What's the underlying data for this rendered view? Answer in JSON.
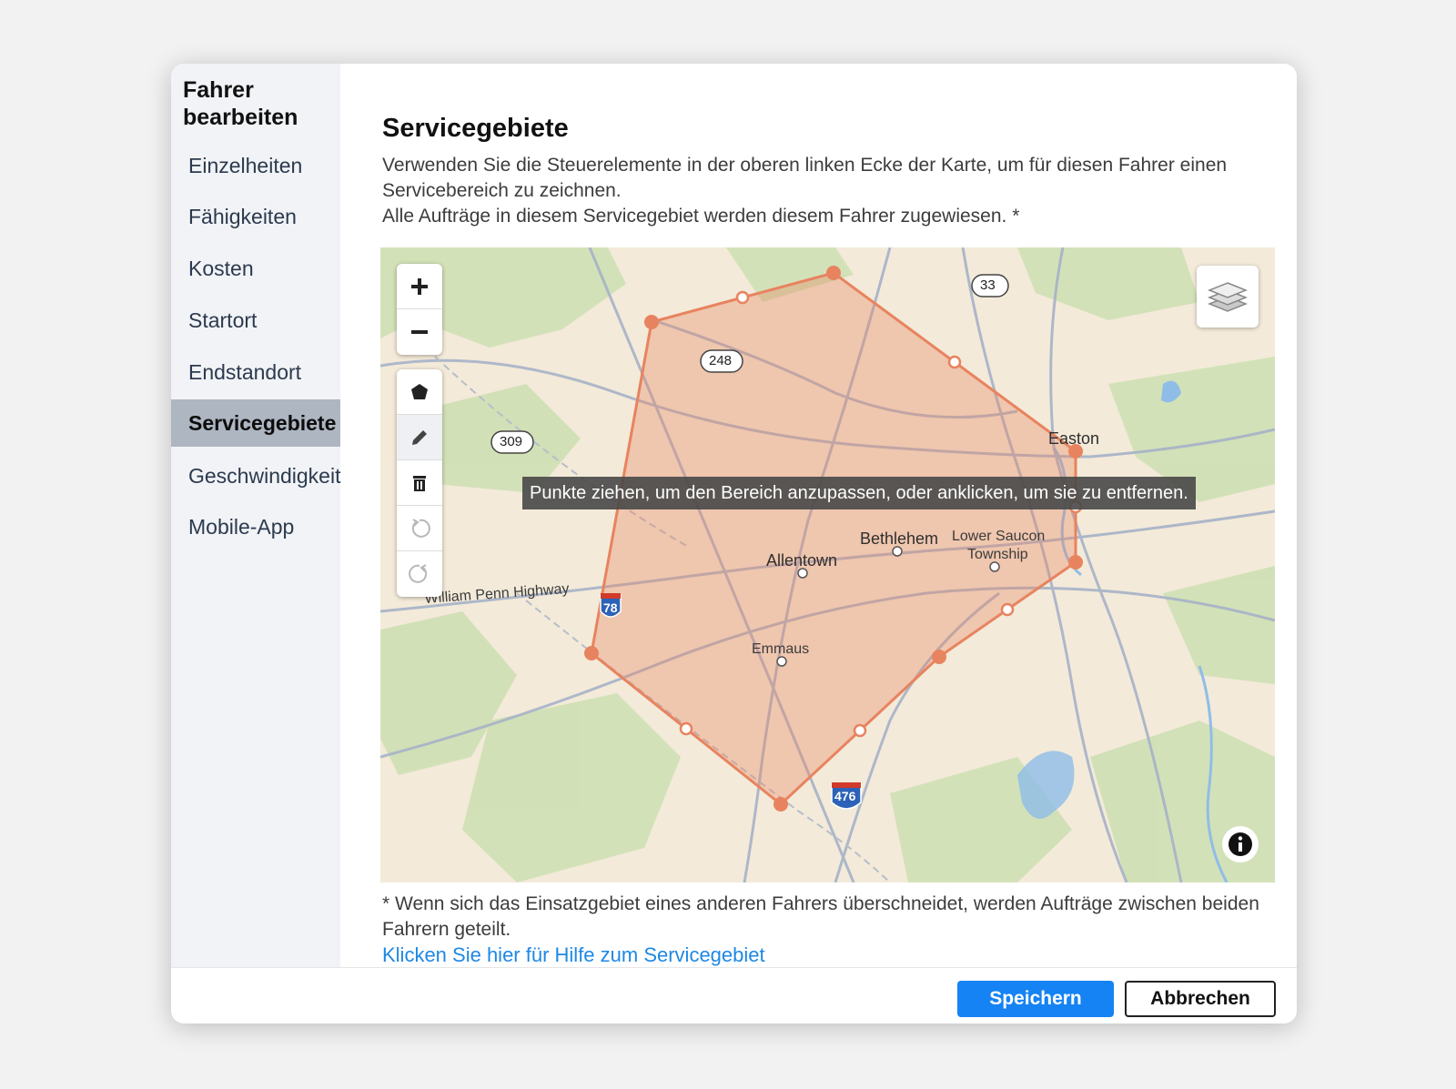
{
  "sidebar": {
    "title": "Fahrer bearbeiten",
    "items": [
      {
        "label": "Einzelheiten"
      },
      {
        "label": "Fähigkeiten"
      },
      {
        "label": "Kosten"
      },
      {
        "label": "Startort"
      },
      {
        "label": "Endstandort"
      },
      {
        "label": "Servicegebiete",
        "active": true
      },
      {
        "label": "Geschwindigkeit"
      },
      {
        "label": "Mobile-App"
      }
    ]
  },
  "main": {
    "heading": "Servicegebiete",
    "description_line1": "Verwenden Sie die Steuerelemente in der oberen linken Ecke der Karte, um für diesen Fahrer einen Servicebereich zu zeichnen.",
    "description_line2": "Alle Aufträge in diesem Servicegebiet werden diesem Fahrer zugewiesen. *",
    "footnote": "* Wenn sich das Einsatzgebiet eines anderen Fahrers überschneidet, werden Aufträge zwischen beiden Fahrern geteilt.",
    "help_link": "Klicken Sie hier für Hilfe zum Servicegebiet"
  },
  "map": {
    "tooltip": "Punkte ziehen, um den Bereich anzupassen, oder anklicken, um sie zu entfernen.",
    "polygon_color": "#e8835f",
    "labels": {
      "easton": "Easton",
      "bethlehem": "Bethlehem",
      "allentown": "Allentown",
      "lower_saucon_1": "Lower Saucon",
      "lower_saucon_2": "Township",
      "emmaus": "Emmaus",
      "william_penn": "William Penn Highway"
    },
    "route_shields": {
      "r33": "33",
      "r248": "248",
      "r309": "309",
      "i78": "78",
      "i476": "476"
    },
    "controls": [
      "zoom-in-icon",
      "zoom-out-icon",
      "polygon-icon",
      "pencil-icon",
      "trash-icon",
      "undo-icon",
      "redo-icon",
      "layers-icon",
      "info-icon"
    ]
  },
  "footer": {
    "save_label": "Speichern",
    "cancel_label": "Abbrechen"
  }
}
